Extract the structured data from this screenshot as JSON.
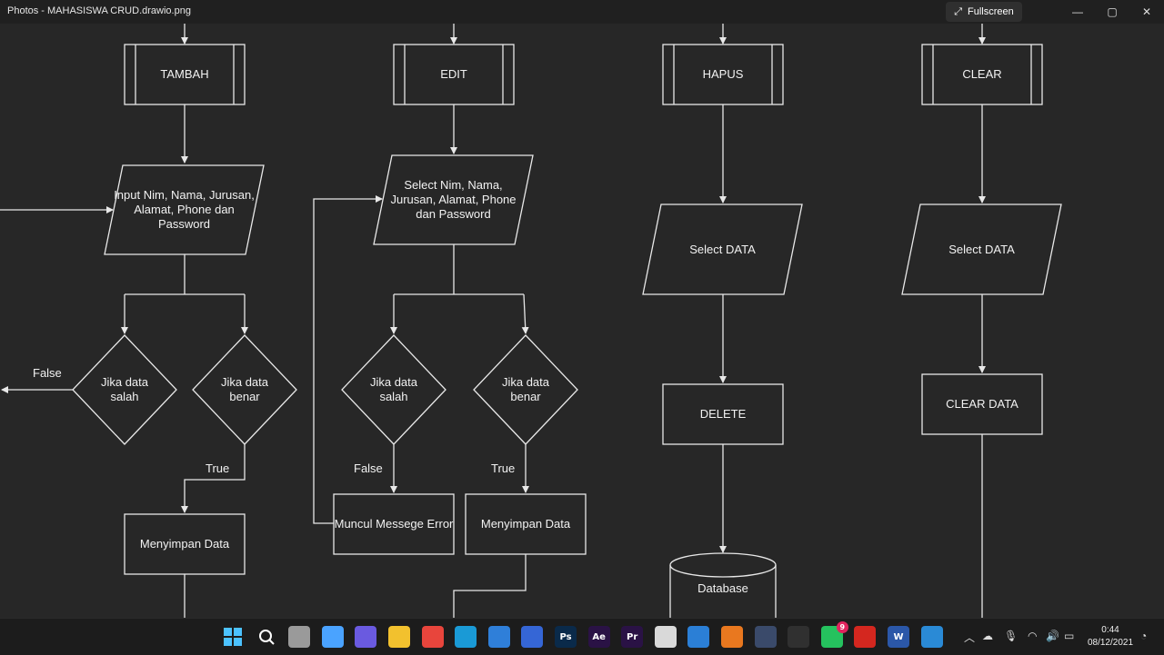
{
  "window": {
    "title": "Photos - MAHASISWA CRUD.drawio.png",
    "fullscreen_label": "Fullscreen",
    "controls": {
      "minimize": "—",
      "maximize": "▢",
      "close": "✕"
    }
  },
  "flowchart": {
    "col1": {
      "process": "TAMBAH",
      "input": "Input Nim, Nama, Jurusan, Alamat, Phone dan Password",
      "decision_wrong": "Jika data salah",
      "decision_right": "Jika data benar",
      "label_false": "False",
      "label_true": "True",
      "save": "Menyimpan Data"
    },
    "col2": {
      "process": "EDIT",
      "select": "Select Nim, Nama, Jurusan, Alamat, Phone dan Password",
      "decision_wrong": "Jika data salah",
      "decision_right": "Jika data benar",
      "label_false": "False",
      "label_true": "True",
      "error": "Muncul Messege Error",
      "save": "Menyimpan Data"
    },
    "col3": {
      "process": "HAPUS",
      "select": "Select DATA",
      "delete": "DELETE",
      "database": "Database"
    },
    "col4": {
      "process": "CLEAR",
      "select": "Select DATA",
      "clear": "CLEAR DATA"
    }
  },
  "taskbar": {
    "apps": [
      {
        "name": "start-icon",
        "label": ""
      },
      {
        "name": "search-icon",
        "label": ""
      },
      {
        "name": "task-view-icon",
        "label": ""
      },
      {
        "name": "widgets-icon",
        "label": ""
      },
      {
        "name": "chat-icon",
        "label": ""
      },
      {
        "name": "file-explorer-icon",
        "label": ""
      },
      {
        "name": "chrome-icon",
        "label": ""
      },
      {
        "name": "edge-icon",
        "label": ""
      },
      {
        "name": "mail-icon",
        "label": ""
      },
      {
        "name": "tool-icon",
        "label": ""
      },
      {
        "name": "photoshop-icon",
        "label": "Ps"
      },
      {
        "name": "after-effects-icon",
        "label": "Ae"
      },
      {
        "name": "premiere-icon",
        "label": "Pr"
      },
      {
        "name": "app-hex-icon",
        "label": ""
      },
      {
        "name": "vscode-icon",
        "label": ""
      },
      {
        "name": "xampp-icon",
        "label": ""
      },
      {
        "name": "network-app-icon",
        "label": ""
      },
      {
        "name": "obs-icon",
        "label": ""
      },
      {
        "name": "whatsapp-icon",
        "label": ""
      },
      {
        "name": "acrobat-icon",
        "label": ""
      },
      {
        "name": "word-icon",
        "label": "W"
      },
      {
        "name": "photos-icon",
        "label": ""
      }
    ],
    "whatsapp_badge": "9",
    "clock_time": "0:44",
    "clock_date": "08/12/2021"
  },
  "colors": {
    "background": "#272727",
    "stroke": "#e8e8e8",
    "taskbar": "#1c1c1c"
  }
}
